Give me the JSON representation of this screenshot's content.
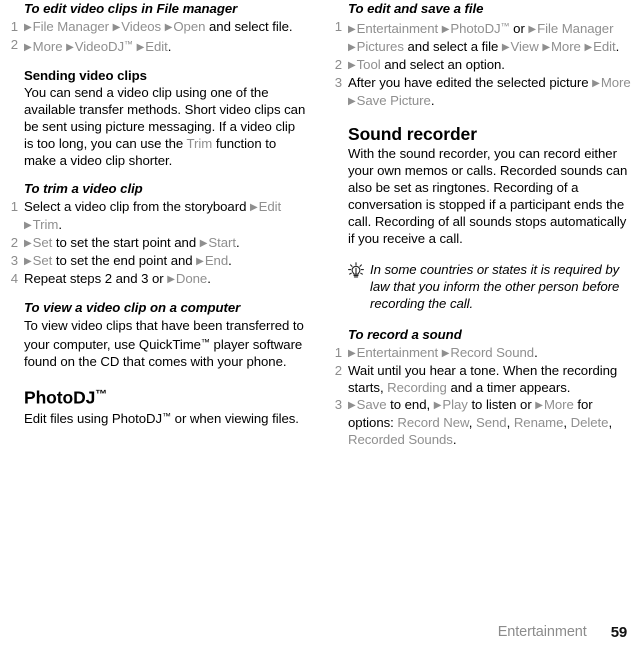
{
  "page": {
    "footer_section": "Entertainment",
    "footer_page_number": "59",
    "ui_accent_color": "#8f8f8f",
    "text_color": "#000000"
  },
  "left_column": {
    "heading_edit_video": "To edit video clips in File manager",
    "steps_edit_video": [
      {
        "num": "1",
        "text": "▶ File Manager ▶ Videos ▶ Open and select file."
      },
      {
        "num": "2",
        "text": "▶ More ▶ VideoDJ™ ▶ Edit."
      }
    ],
    "heading_sending": "Sending video clips",
    "para_sending": "You can send a video clip using one of the available transfer methods. Short video clips can be sent using picture messaging. If a video clip is too long, you can use the Trim function to make a video clip shorter.",
    "para_sending_parts": {
      "a": "You can send a video clip using one of the available transfer methods. Short video clips can be sent using picture messaging. If a video clip is too long, you can use the ",
      "ui": "Trim",
      "b": " function to make a video clip shorter."
    },
    "heading_trim": "To trim a video clip",
    "steps_trim": [
      {
        "num": "1",
        "text": "Select a video clip from the storyboard ▶ Edit ▶ Trim."
      },
      {
        "num": "2",
        "text": "▶ Set to set the start point and ▶ Start."
      },
      {
        "num": "3",
        "text": "▶ Set to set the end point and ▶ End."
      },
      {
        "num": "4",
        "text": "Repeat steps 2 and 3 or ▶ Done."
      }
    ],
    "heading_view_computer": "To view a video clip on a computer",
    "para_view_computer": "To view video clips that have been transferred to your computer, use QuickTime™ player software found on the CD that comes with your phone.",
    "heading_photodj": "PhotoDJ™",
    "para_photodj": "Edit files using PhotoDJ™ or when viewing files."
  },
  "right_column": {
    "heading_edit_save": "To edit and save a file",
    "steps_edit_save": [
      {
        "num": "1",
        "text": "▶ Entertainment ▶ PhotoDJ™ or ▶ File Manager ▶ Pictures and select a file ▶ View ▶ More ▶ Edit."
      },
      {
        "num": "2",
        "text": "▶ Tool and select an option."
      },
      {
        "num": "3",
        "text": "After you have edited the selected picture ▶ More ▶ Save Picture."
      }
    ],
    "heading_sound_recorder": "Sound recorder",
    "para_sound_recorder": "With the sound recorder, you can record either your own memos or calls. Recorded sounds can also be set as ringtones. Recording of a conversation is stopped if a participant ends the call. Recording of all sounds stops automatically if you receive a call.",
    "tip_icon": "light-bulb-icon",
    "tip_text": "In some countries or states it is required by law that you inform the other person before recording the call.",
    "heading_record_sound": "To record a sound",
    "steps_record_sound": [
      {
        "num": "1",
        "text": "▶ Entertainment ▶ Record Sound."
      },
      {
        "num": "2",
        "text": "Wait until you hear a tone. When the recording starts, Recording and a timer appears."
      },
      {
        "num": "3",
        "text": "▶ Save to end, ▶ Play to listen or ▶ More for options: Record New, Send, Rename, Delete, Recorded Sounds."
      }
    ]
  }
}
